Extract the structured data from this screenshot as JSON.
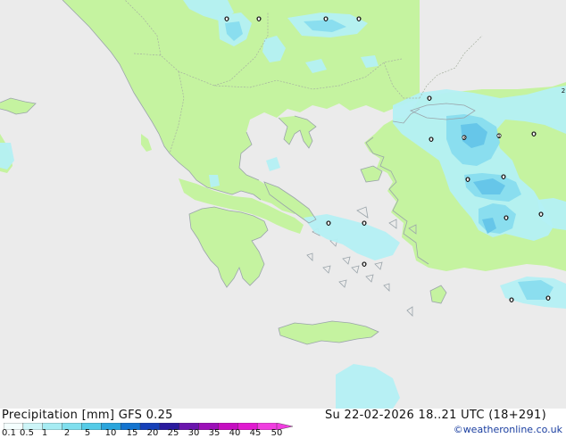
{
  "map": {
    "colors": {
      "sea": "#ebebeb",
      "land": "#c5f3a0",
      "coast": "#9aa4aa",
      "precip_light": "#b4f0f4",
      "precip_mid": "#88dcee",
      "precip_heavy": "#64c4e8"
    },
    "station_values": [
      {
        "id": "s1",
        "value": "0"
      },
      {
        "id": "s2",
        "value": "0"
      },
      {
        "id": "s3",
        "value": "0"
      },
      {
        "id": "s4",
        "value": "0"
      },
      {
        "id": "s5",
        "value": "0"
      },
      {
        "id": "s6",
        "value": "0"
      },
      {
        "id": "s7",
        "value": "3"
      },
      {
        "id": "s8",
        "value": "1"
      },
      {
        "id": "s9",
        "value": "0"
      },
      {
        "id": "s10",
        "value": "0"
      },
      {
        "id": "s11",
        "value": "0"
      },
      {
        "id": "s12",
        "value": "0"
      },
      {
        "id": "s13",
        "value": "0"
      },
      {
        "id": "s14",
        "value": "0"
      },
      {
        "id": "s15",
        "value": "0"
      },
      {
        "id": "s16",
        "value": "0"
      },
      {
        "id": "s17",
        "value": "0"
      },
      {
        "id": "s18",
        "value": "0"
      },
      {
        "id": "s19",
        "value": "0"
      },
      {
        "id": "s20",
        "value": "2"
      }
    ]
  },
  "footer": {
    "title": "Precipitation [mm]  GFS 0.25",
    "datetime": "Su 22-02-2026 18..21 UTC (18+291)",
    "credit": "©weatheronline.co.uk",
    "legend_labels": [
      "0.1",
      "0.5",
      "1",
      "2",
      "5",
      "10",
      "15",
      "20",
      "25",
      "30",
      "35",
      "40",
      "45",
      "50"
    ],
    "legend_colors": [
      "#f4fefe",
      "#cdf5f8",
      "#a6ecf3",
      "#7fdfee",
      "#55cbe7",
      "#2aa5dc",
      "#1474cf",
      "#1640b8",
      "#2a1a9e",
      "#6a15ad",
      "#9c10b8",
      "#c50ec1",
      "#e01ad0",
      "#f03ee0"
    ]
  }
}
